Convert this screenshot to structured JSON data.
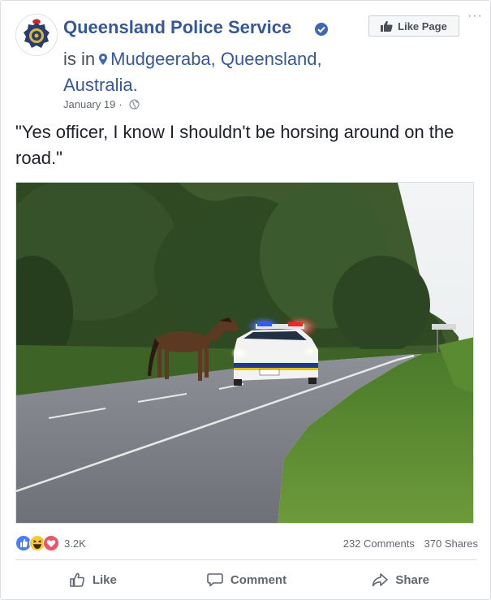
{
  "post": {
    "page_name": "Queensland Police Service",
    "checkin_prefix": "is in",
    "location": "Mudgeeraba, Queensland, Australia.",
    "date": "January 19",
    "meta_sep": "·",
    "text": "\"Yes officer, I know I shouldn't be horsing around on the road.\"",
    "like_page_label": "Like Page",
    "more_label": "···"
  },
  "engagement": {
    "reaction_count": "3.2K",
    "comments": "232 Comments",
    "shares": "370 Shares"
  },
  "actions": {
    "like": "Like",
    "comment": "Comment",
    "share": "Share"
  },
  "colors": {
    "link_blue": "#365899",
    "verified_blue": "#4267b2",
    "muted": "#616770"
  },
  "icons": [
    "verified-badge-icon",
    "location-pin-icon",
    "globe-icon",
    "thumbs-up-icon",
    "comment-bubble-icon",
    "share-arrow-icon",
    "like-reaction-icon",
    "haha-reaction-icon",
    "love-reaction-icon"
  ]
}
